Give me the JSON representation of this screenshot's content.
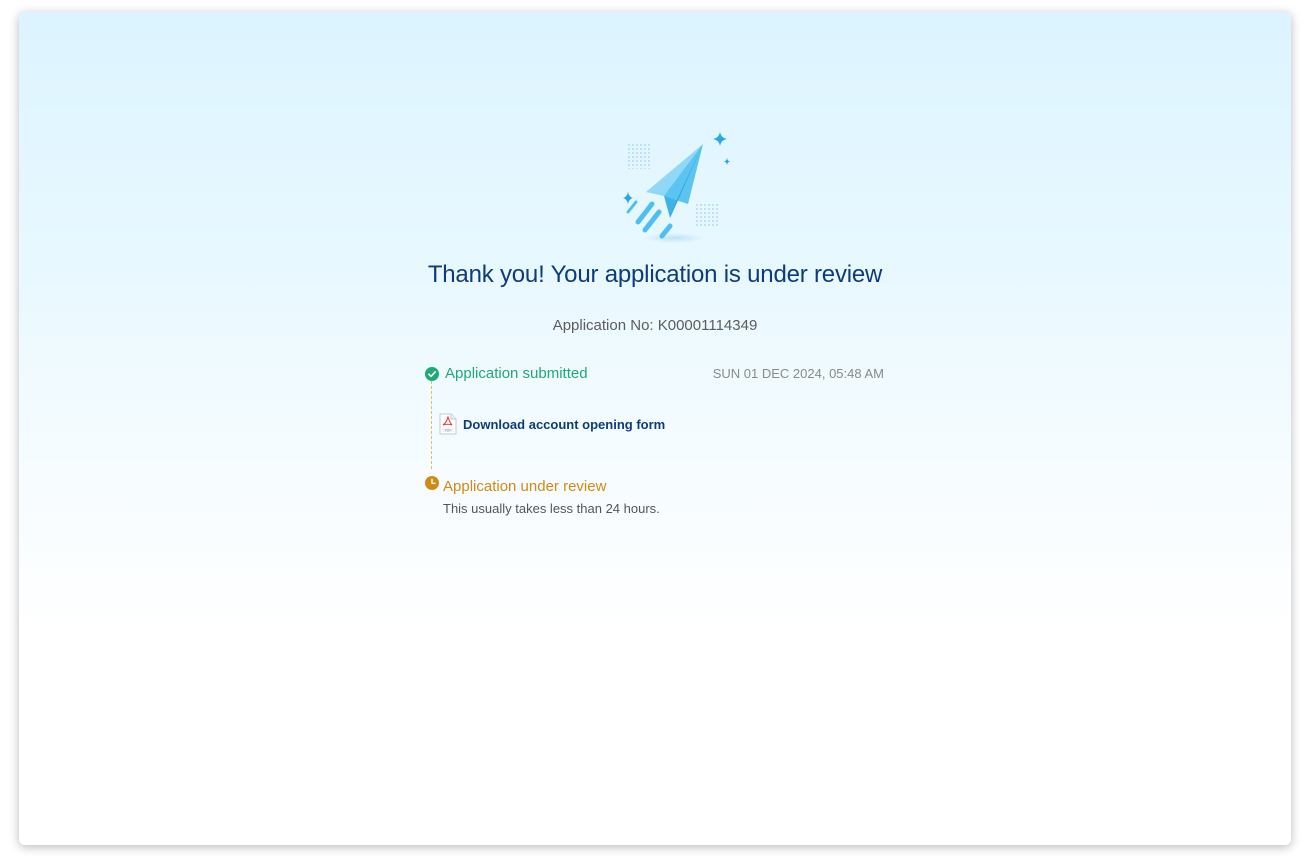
{
  "header": {
    "illustration": "paper-plane-icon",
    "title": "Thank you! Your application is under review",
    "application_no": "Application No: K00001114349"
  },
  "timeline": {
    "submitted": {
      "icon": "check-circle-icon",
      "label": "Application submitted",
      "timestamp": "SUN 01 DEC 2024, 05:48 AM"
    },
    "download": {
      "icon": "pdf-icon",
      "label": "Download account opening form"
    },
    "review": {
      "icon": "clock-icon",
      "label": "Application under review",
      "note": "This usually takes less than 24 hours."
    }
  },
  "colors": {
    "title": "#0c3d78",
    "success": "#1eaa78",
    "pending": "#d08b14",
    "plane": "#4ec0f0"
  }
}
